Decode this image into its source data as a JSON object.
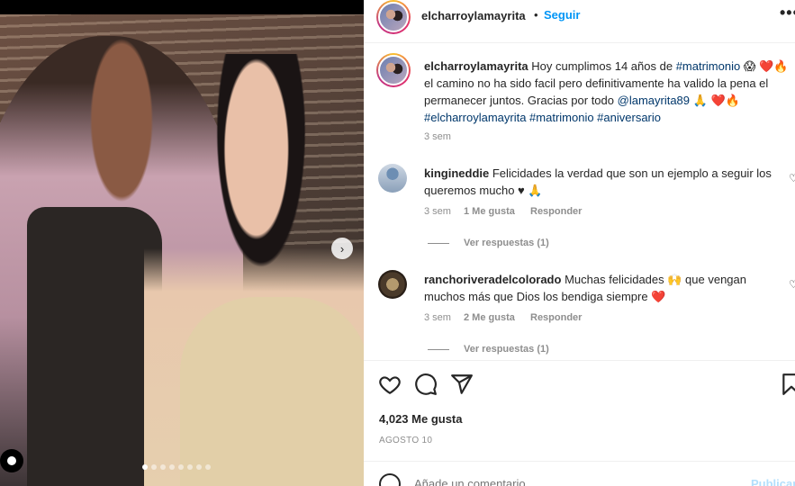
{
  "post": {
    "username": "elcharroylamayrita",
    "follow_label": "Seguir",
    "separator": "•",
    "more_label": "•••",
    "next_arrow": "›",
    "carousel_dots": 8
  },
  "caption": {
    "username": "elcharroylamayrita",
    "text_1": "Hoy cumplimos 14 años de",
    "tag_matrimonio": "#matrimonio",
    "emoji_1": "😱",
    "emoji_2": "❤️🔥",
    "text_2": "el camino no ha sido facil pero definitivamente ha valido la pena el permanecer juntos. Gracias por todo",
    "mention": "@lamayrita89",
    "emoji_3": "🙏",
    "emoji_4": "❤️🔥",
    "hashtags": "#elcharroylamayrita #matrimonio #aniversario",
    "time": "3 sem"
  },
  "comments": [
    {
      "username": "kingineddie",
      "text": "Felicidades la verdad que son un ejemplo a seguir los queremos mucho ♥ 🙏",
      "time": "3 sem",
      "likes": "1 Me gusta",
      "reply": "Responder",
      "view_replies": "Ver respuestas (1)"
    },
    {
      "username": "ranchoriveradelcolorado",
      "text": "Muchas felicidades 🙌 que vengan muchos más que Dios los bendiga siempre ❤️",
      "time": "3 sem",
      "likes": "2 Me gusta",
      "reply": "Responder",
      "view_replies": "Ver respuestas (1)"
    }
  ],
  "footer": {
    "likes": "4,023 Me gusta",
    "date": "AGOSTO 10",
    "comment_placeholder": "Añade un comentario...",
    "publish_label": "Publicar"
  }
}
